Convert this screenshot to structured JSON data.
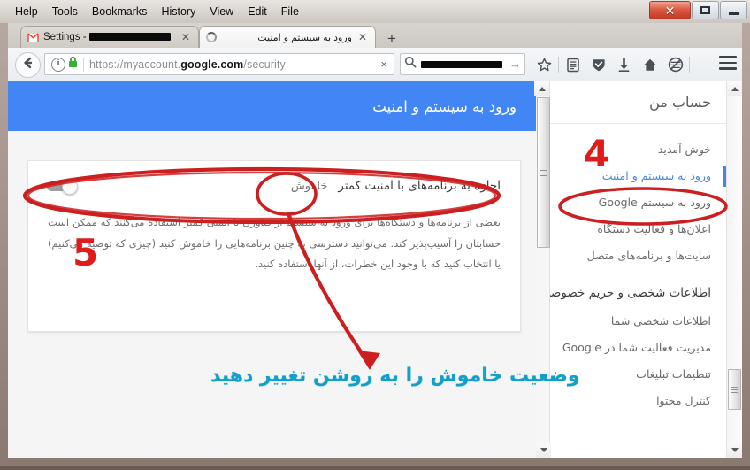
{
  "window": {
    "menus": [
      "File",
      "Edit",
      "View",
      "History",
      "Bookmarks",
      "Tools",
      "Help"
    ],
    "controls": {
      "minimize": "minimize",
      "maximize": "maximize",
      "close": "close"
    }
  },
  "tabs": [
    {
      "title": "Settings -",
      "redacted": true,
      "favicon": "gmail-icon",
      "active": false
    },
    {
      "title": "ورود به سیستم و امنیت",
      "redacted": false,
      "favicon": "loading-spinner-icon",
      "active": true
    }
  ],
  "newtab_label": "+",
  "toolbar": {
    "back_label": "Back",
    "url": "https://myaccount.google.com/security",
    "url_host": "google.com",
    "url_scheme": "https://myaccount.",
    "url_path": "/security",
    "url_clear_label": "×",
    "search_placeholder": "",
    "search_value_redacted": true,
    "search_go_label": "→",
    "icons": [
      "star-icon",
      "reader-mode-icon",
      "shield-icon",
      "download-icon",
      "home-icon",
      "pocket-icon",
      "hamburger-menu-icon"
    ]
  },
  "page": {
    "header_title": "ورود به سیستم و امنیت",
    "sidebar": {
      "title": "حساب من",
      "items": [
        {
          "label": "خوش آمدید",
          "active": false,
          "section": false
        },
        {
          "label": "ورود به سیستم و امنیت",
          "active": true,
          "section": false
        },
        {
          "label": "ورود به سیستم Google",
          "active": false,
          "section": false
        },
        {
          "label": "اعلان‌ها و فعالیت دستگاه",
          "active": false,
          "section": false
        },
        {
          "label": "سایت‌ها و برنامه‌های متصل",
          "active": false,
          "section": false
        },
        {
          "label": "اطلاعات شخصی و حریم خصوصی",
          "active": false,
          "section": true
        },
        {
          "label": "اطلاعات شخصی شما",
          "active": false,
          "section": false
        },
        {
          "label": "مدیریت فعالیت شما در Google",
          "active": false,
          "section": false
        },
        {
          "label": "تنظیمات تبلیغات",
          "active": false,
          "section": false
        },
        {
          "label": "کنترل محتوا",
          "active": false,
          "section": false
        }
      ]
    },
    "card": {
      "title": "اجازه به برنامه‌های با امنیت کمتر",
      "status": "خاموش",
      "toggle_state": "off",
      "body": "بعضی از برنامه‌ها و دستگاه‌ها برای ورود به سیستم از فناوری با ایمنی کمتر استفاده می‌کنند که ممکن است حسابتان را آسیب‌پذیر کند. می‌توانید دسترسی به چنین برنامه‌هایی را خاموش کنید (چیزی که توصیه می‌کنیم) یا انتخاب کنید که با وجود این خطرات، از آنها استفاده کنید."
    }
  },
  "annotations": {
    "step_4": "4",
    "step_5": "5",
    "instruction": "وضعیت خاموش را به روشن تغییر دهید",
    "colors": {
      "marker_red": "#e01b1b",
      "instruction_teal": "#13a0c8",
      "accent_blue": "#4285f4"
    }
  }
}
